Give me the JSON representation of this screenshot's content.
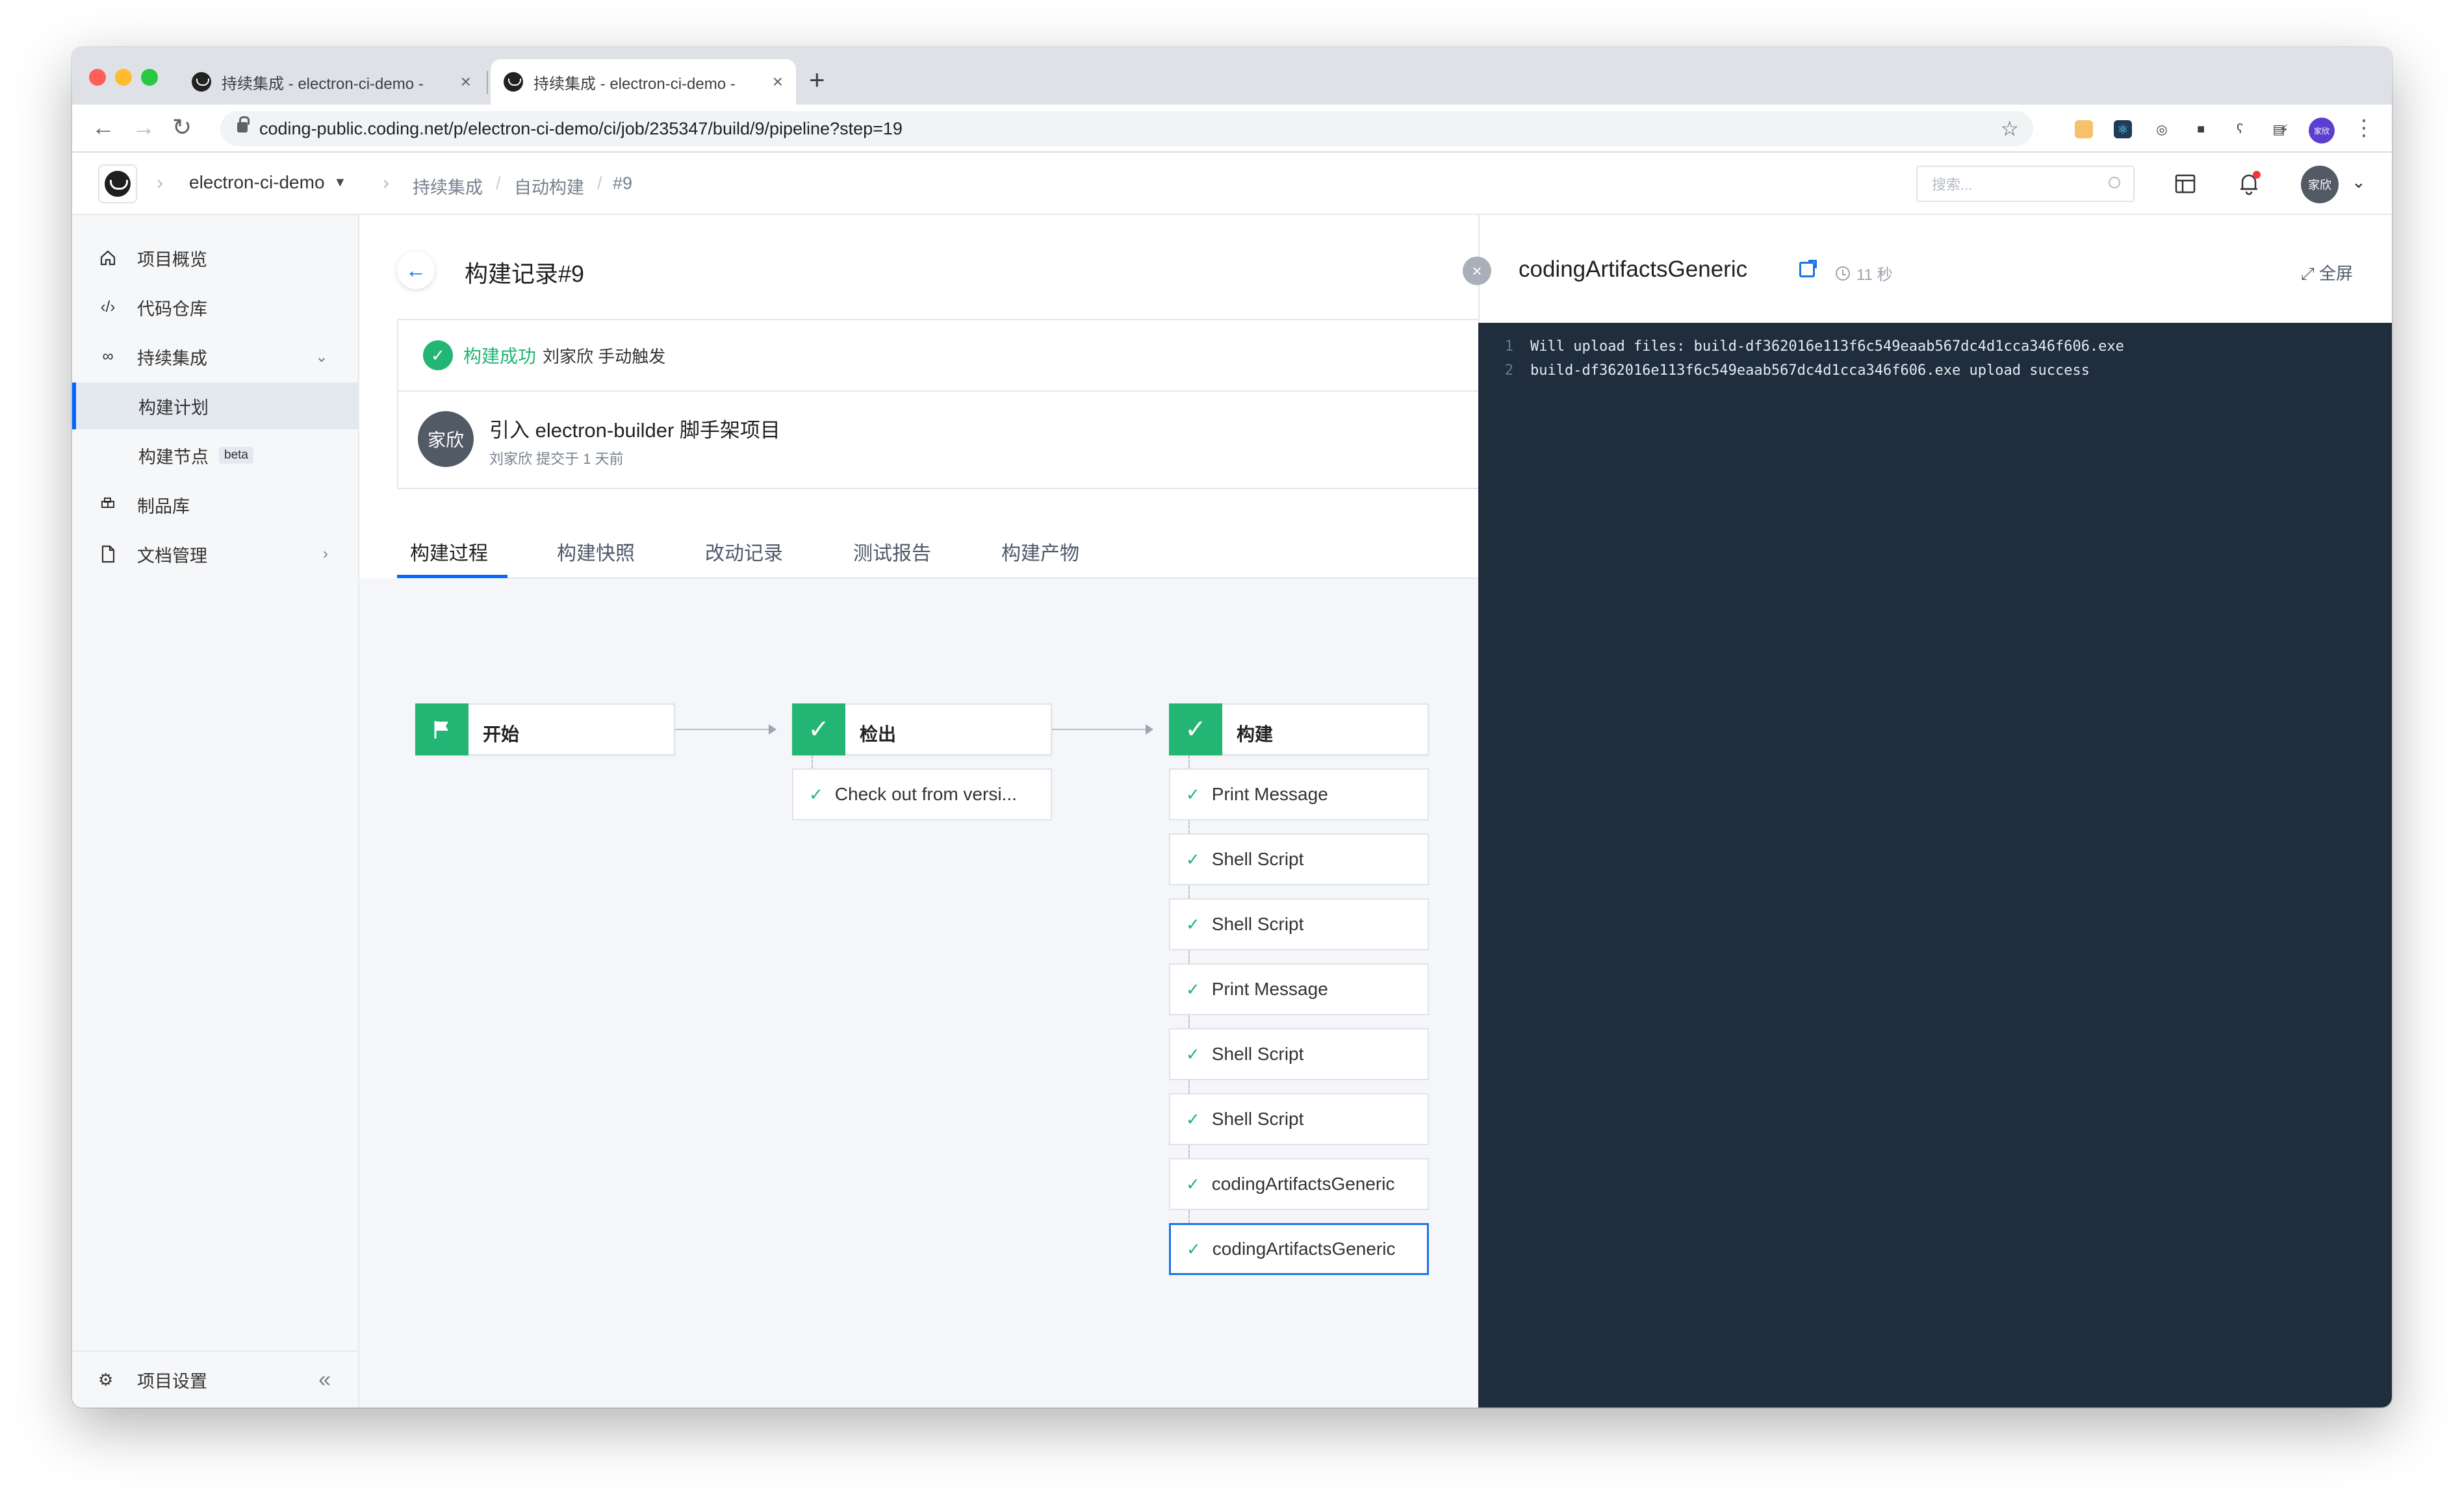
{
  "browser": {
    "tabs": [
      {
        "title": "持续集成 - electron-ci-demo - ",
        "close": "×"
      },
      {
        "title": "持续集成 - electron-ci-demo - ",
        "close": "×"
      }
    ],
    "new_tab": "+",
    "url": "coding-public.coding.net/p/electron-ci-demo/ci/job/235347/build/9/pipeline?step=19",
    "profile_initials": "家欣",
    "traffic_colors": [
      "#ff5f57",
      "#febc2e",
      "#28c840"
    ]
  },
  "header": {
    "project": "electron-ci-demo",
    "breadcrumbs": [
      "持续集成",
      "自动构建",
      "#9"
    ],
    "search_placeholder": "搜索...",
    "avatar": "家欣"
  },
  "sidebar": {
    "items": [
      {
        "label": "项目概览",
        "icon": "home-icon"
      },
      {
        "label": "代码仓库",
        "icon": "code-icon"
      },
      {
        "label": "持续集成",
        "icon": "infinity-icon",
        "expanded": true
      },
      {
        "label": "构建计划",
        "sub": true,
        "active": true
      },
      {
        "label": "构建节点",
        "sub": true,
        "badge": "beta"
      },
      {
        "label": "制品库",
        "icon": "artifact-icon"
      },
      {
        "label": "文档管理",
        "icon": "document-icon"
      }
    ],
    "footer": "项目设置"
  },
  "build": {
    "title": "构建记录#9",
    "status": "构建成功",
    "triggered_by": "刘家欣 手动触发",
    "commit_avatar": "家欣",
    "commit_title": "引入 electron-builder 脚手架项目",
    "commit_meta": "刘家欣 提交于 1 天前",
    "tabs": [
      "构建过程",
      "构建快照",
      "改动记录",
      "测试报告",
      "构建产物"
    ],
    "active_tab": 0
  },
  "pipeline": {
    "stages": [
      {
        "name": "开始",
        "steps": []
      },
      {
        "name": "检出",
        "steps": [
          "Check out from versi..."
        ]
      },
      {
        "name": "构建",
        "steps": [
          "Print Message",
          "Shell Script",
          "Shell Script",
          "Print Message",
          "Shell Script",
          "Shell Script",
          "codingArtifactsGeneric",
          "codingArtifactsGeneric"
        ]
      }
    ],
    "selected_step": "codingArtifactsGeneric",
    "status_color": "#22b573"
  },
  "log": {
    "title": "codingArtifactsGeneric",
    "duration": "11 秒",
    "fullscreen": "全屏",
    "lines": [
      {
        "n": "1",
        "text": "Will upload files: build-df362016e113f6c549eaab567dc4d1cca346f606.exe"
      },
      {
        "n": "2",
        "text": "build-df362016e113f6c549eaab567dc4d1cca346f606.exe upload success"
      }
    ]
  }
}
